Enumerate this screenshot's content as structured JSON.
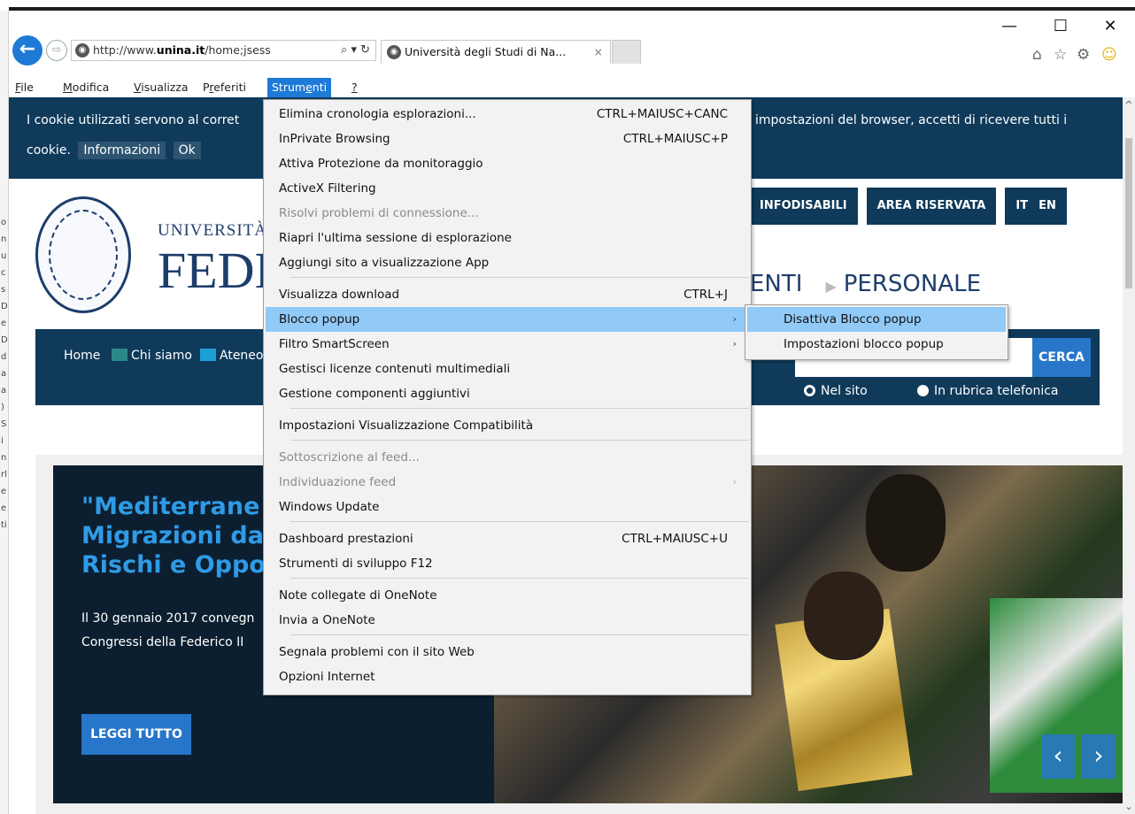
{
  "browser": {
    "address_prefix": "http://www.",
    "address_domain": "unina.it",
    "address_suffix": "/home;jsess",
    "address_tools": "⌕ ▾ ↻",
    "tab_title": "Università degli Studi di Na...",
    "tab_close": "×",
    "window_controls": [
      "—",
      "☐",
      "✕"
    ],
    "right_tools": [
      "⌂",
      "☆",
      "⚙",
      "☺"
    ]
  },
  "menubar": {
    "items": [
      {
        "label": "File",
        "underline": "F"
      },
      {
        "label": "Modifica",
        "underline": "M"
      },
      {
        "label": "Visualizza",
        "underline": "V"
      },
      {
        "label": "Preferiti",
        "underline": "r"
      },
      {
        "label": "Strumenti",
        "underline": "e"
      },
      {
        "label": "?",
        "underline": "?"
      }
    ],
    "active": "Strumenti"
  },
  "left_strip": [
    "o",
    "n",
    "u",
    "c",
    "s",
    "D",
    "e",
    "D",
    "d",
    "a",
    "a",
    ")",
    "S",
    "i",
    "n",
    "rl",
    "e",
    "e",
    "ti"
  ],
  "cookie": {
    "line1_left": "I cookie utilizzati servono al corret",
    "line1_right": "impostazioni del browser, accetti di ricevere tutti i",
    "line2_text": "cookie.",
    "info_button": "Informazioni",
    "ok_button": "Ok"
  },
  "site": {
    "uni_small": "UNIVERSITÀ D",
    "uni_big": "FEDE",
    "top_links": [
      "INFODISABILI",
      "AREA RISERVATA",
      "IT",
      "EN"
    ],
    "big_menu": [
      "ENTI",
      "PERSONALE"
    ],
    "nav": [
      {
        "label": "Home",
        "color": "#0f3a5a"
      },
      {
        "label": "Chi siamo",
        "color": "#2a8a8a"
      },
      {
        "label": "Ateneo",
        "color": "#1e9fd6"
      }
    ],
    "search_button": "CERCA",
    "radio_site": "Nel sito",
    "radio_phone": "In rubrica telefonica",
    "hero_title": "\"Mediterrane\nMigrazioni dal\nRischi e Oppor",
    "hero_text": "Il 30 gennaio 2017 convegn\nCongressi della Federico II",
    "read_more": "LEGGI TUTTO",
    "prev": "‹",
    "next": "›"
  },
  "tools_menu": {
    "items": [
      {
        "label": "Elimina cronologia esplorazioni...",
        "shortcut": "CTRL+MAIUSC+CANC"
      },
      {
        "label": "InPrivate Browsing",
        "shortcut": "CTRL+MAIUSC+P"
      },
      {
        "label": "Attiva Protezione da monitoraggio"
      },
      {
        "label": "ActiveX Filtering"
      },
      {
        "label": "Risolvi problemi di connessione...",
        "disabled": true
      },
      {
        "label": "Riapri l'ultima sessione di esplorazione"
      },
      {
        "label": "Aggiungi sito a visualizzazione App"
      },
      {
        "label": "Visualizza download",
        "shortcut": "CTRL+J"
      },
      {
        "label": "Blocco popup",
        "submenu": true,
        "highlighted": true
      },
      {
        "label": "Filtro SmartScreen",
        "submenu": true
      },
      {
        "label": "Gestisci licenze contenuti multimediali"
      },
      {
        "label": "Gestione componenti aggiuntivi"
      },
      {
        "label": "Impostazioni Visualizzazione Compatibilità"
      },
      {
        "label": "Sottoscrizione al feed...",
        "disabled": true
      },
      {
        "label": "Individuazione feed",
        "disabled": true,
        "submenu": true
      },
      {
        "label": "Windows Update"
      },
      {
        "label": "Dashboard prestazioni",
        "shortcut": "CTRL+MAIUSC+U"
      },
      {
        "label": "Strumenti di sviluppo F12"
      },
      {
        "label": "Note collegate di OneNote"
      },
      {
        "label": "Invia a OneNote"
      },
      {
        "label": "Segnala problemi con il sito Web"
      },
      {
        "label": "Opzioni Internet"
      }
    ]
  },
  "popup_submenu": {
    "items": [
      {
        "label": "Disattiva Blocco popup",
        "highlighted": true
      },
      {
        "label": "Impostazioni blocco popup"
      }
    ]
  },
  "colors": {
    "accent": "#1e7ad6",
    "menu_highlight": "#91c9f7",
    "site_navy": "#0f3a5a",
    "site_blue": "#2776c9"
  }
}
